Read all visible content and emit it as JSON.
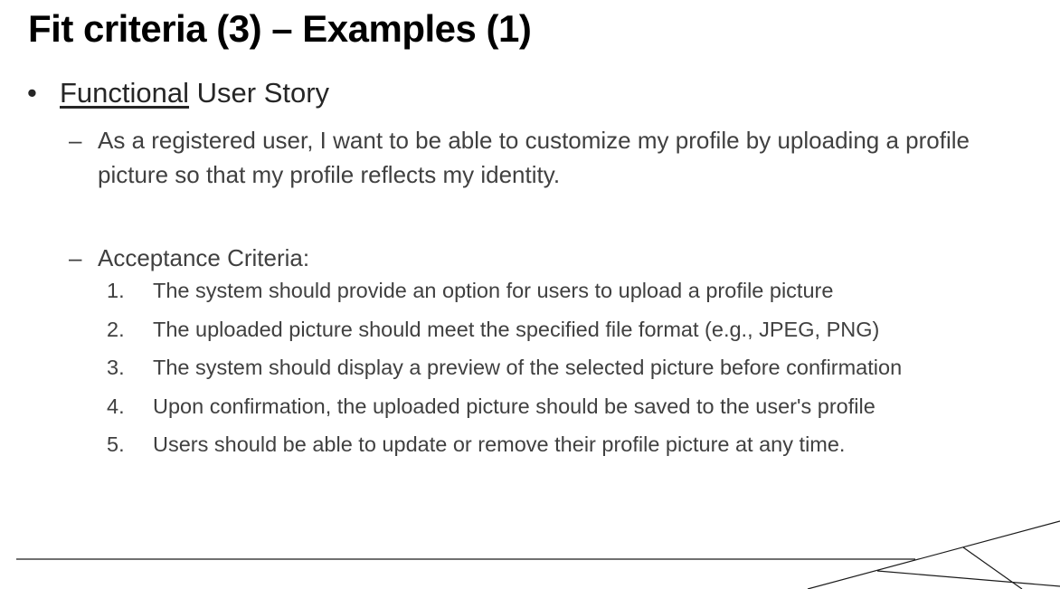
{
  "slide": {
    "title": "Fit criteria (3) – Examples (1)",
    "bullet": {
      "symbol": "•",
      "underlined_word": "Functional",
      "rest": " User Story"
    },
    "story": {
      "dash": "–",
      "text": "As a registered user, I want to be able to customize my profile by uploading a profile picture so that my profile reflects my identity."
    },
    "criteria": {
      "dash": "–",
      "heading": "Acceptance Criteria:",
      "items": [
        {
          "num": "1.",
          "text": "The system should provide an option for users to upload a profile picture"
        },
        {
          "num": "2.",
          "text": "The uploaded picture should meet the specified file format (e.g., JPEG, PNG)"
        },
        {
          "num": "3.",
          "text": "The system should display a preview of the selected picture before confirmation"
        },
        {
          "num": "4.",
          "text": "Upon confirmation, the uploaded picture should be saved to the user's profile"
        },
        {
          "num": "5.",
          "text": "Users should be able to update or remove their profile picture at any time."
        }
      ]
    }
  },
  "colors": {
    "title": "#000000",
    "body": "#404040",
    "rule": "#1a1a1a"
  }
}
